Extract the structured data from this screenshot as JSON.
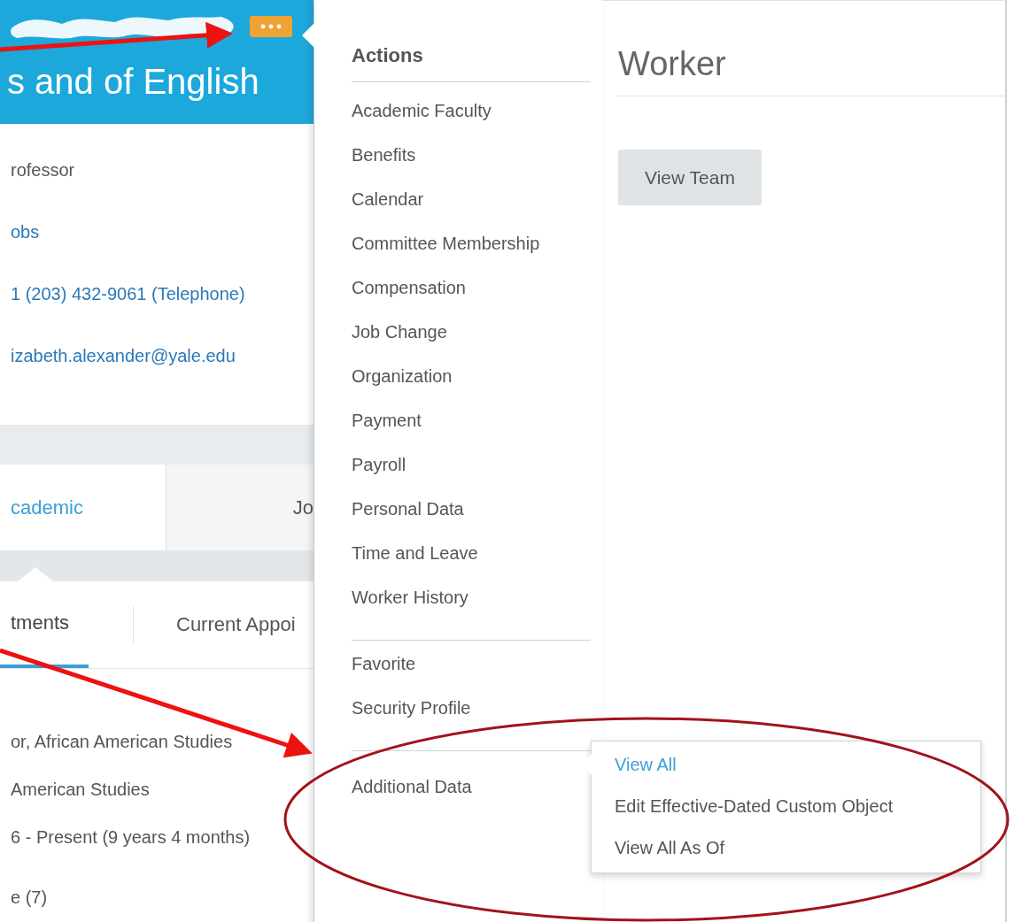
{
  "profile": {
    "title": "s and of English",
    "details": [
      {
        "text": "rofessor",
        "kind": "text"
      },
      {
        "text": "obs",
        "kind": "link"
      },
      {
        "text": "1 (203) 432-9061 (Telephone)",
        "kind": "link"
      },
      {
        "text": "izabeth.alexander@yale.edu",
        "kind": "link"
      }
    ],
    "tabs": [
      {
        "label": "cademic",
        "selected": true
      },
      {
        "label": "Jo",
        "selected": false
      }
    ],
    "subtabs": [
      {
        "label": "tments",
        "selected": true
      },
      {
        "label": "Current Appoi",
        "selected": false
      }
    ],
    "lines": [
      "or, African American Studies",
      "American Studies",
      "6 - Present (9 years 4 months)",
      "e (7)"
    ]
  },
  "actions_menu": {
    "title": "Actions",
    "groups": [
      {
        "items": [
          {
            "label": "Academic Faculty"
          },
          {
            "label": "Benefits"
          },
          {
            "label": "Calendar"
          },
          {
            "label": "Committee Membership"
          },
          {
            "label": "Compensation"
          },
          {
            "label": "Job Change"
          },
          {
            "label": "Organization"
          },
          {
            "label": "Payment"
          },
          {
            "label": "Payroll"
          },
          {
            "label": "Personal Data"
          },
          {
            "label": "Time and Leave"
          },
          {
            "label": "Worker History"
          }
        ]
      },
      {
        "items": [
          {
            "label": "Favorite"
          },
          {
            "label": "Security Profile"
          }
        ]
      },
      {
        "items": [
          {
            "label": "Additional Data",
            "submenu": [
              {
                "label": "View All",
                "selected": true
              },
              {
                "label": "Edit Effective-Dated Custom Object",
                "selected": false
              },
              {
                "label": "View All As Of",
                "selected": false
              }
            ]
          }
        ]
      }
    ]
  },
  "worker": {
    "title": "Worker",
    "button": "View Team"
  }
}
